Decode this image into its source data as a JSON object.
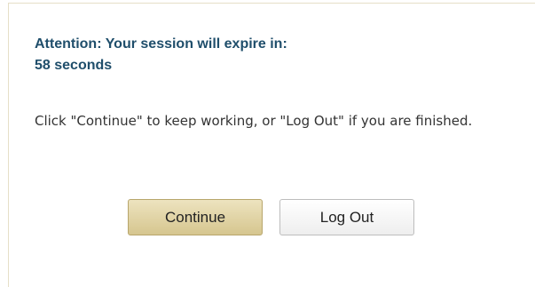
{
  "dialog": {
    "title_line1": "Attention: Your session will expire in:",
    "title_line2": "58 seconds",
    "message": "Click \"Continue\" to keep working, or \"Log Out\" if you are finished.",
    "continue_label": "Continue",
    "logout_label": "Log Out"
  },
  "colors": {
    "title": "#1f4e6b",
    "continue_button": "#ddd0a0",
    "border": "#e6dfc7"
  }
}
